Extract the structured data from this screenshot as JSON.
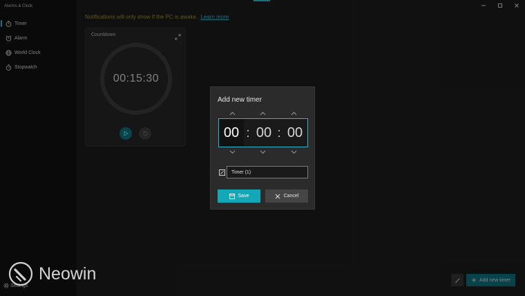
{
  "app": {
    "title": "Alarms & Clock"
  },
  "sidebar": {
    "items": [
      {
        "label": "Timer",
        "icon": "timer-icon",
        "active": true
      },
      {
        "label": "Alarm",
        "icon": "alarm-icon",
        "active": false
      },
      {
        "label": "World Clock",
        "icon": "globe-icon",
        "active": false
      },
      {
        "label": "Stopwatch",
        "icon": "stopwatch-icon",
        "active": false
      }
    ],
    "settings_label": "Settings"
  },
  "notice": {
    "text": "Notifications will only show if the PC is awake.",
    "link": "Learn more"
  },
  "timer_card": {
    "title": "Countdown",
    "time": "00:15:30"
  },
  "dialog": {
    "title": "Add new timer",
    "hours": "00",
    "minutes": "00",
    "seconds": "00",
    "separator": ":",
    "name_value": "Timer (1)",
    "save_label": "Save",
    "cancel_label": "Cancel"
  },
  "footer": {
    "add_label": "Add new timer"
  },
  "watermark": {
    "text": "Neowin"
  },
  "colors": {
    "accent": "#2bb5c7",
    "save_button": "#14a7b8",
    "notice_text": "#9a8a2e"
  }
}
